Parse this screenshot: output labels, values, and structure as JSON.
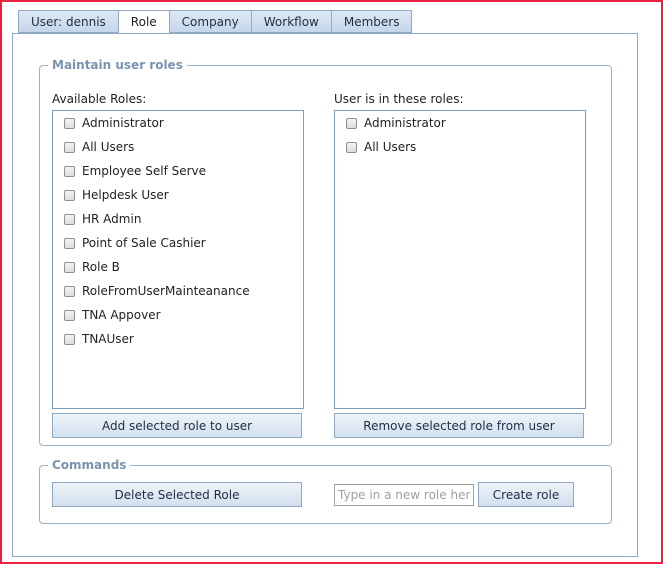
{
  "tabs": [
    {
      "label": "User: dennis",
      "active": false
    },
    {
      "label": "Role",
      "active": true
    },
    {
      "label": "Company",
      "active": false
    },
    {
      "label": "Workflow",
      "active": false
    },
    {
      "label": "Members",
      "active": false
    }
  ],
  "roles_section": {
    "legend": "Maintain user roles",
    "available_label": "Available Roles:",
    "assigned_label": "User is in these roles:",
    "available_roles": [
      "Administrator",
      "All Users",
      "Employee Self Serve",
      "Helpdesk User",
      "HR Admin",
      "Point of Sale Cashier",
      "Role B",
      "RoleFromUserMainteanance",
      "TNA Appover",
      "TNAUser"
    ],
    "assigned_roles": [
      "Administrator",
      "All Users"
    ],
    "add_button": "Add selected role to user",
    "remove_button": "Remove selected role from user"
  },
  "commands_section": {
    "legend": "Commands",
    "delete_button": "Delete Selected Role",
    "new_role_placeholder": "Type in a new role here",
    "create_button": "Create role"
  },
  "colors": {
    "frame_border": "#e8233f",
    "legend_text": "#7b93b0",
    "tab_bg": "#c5d6ea"
  }
}
